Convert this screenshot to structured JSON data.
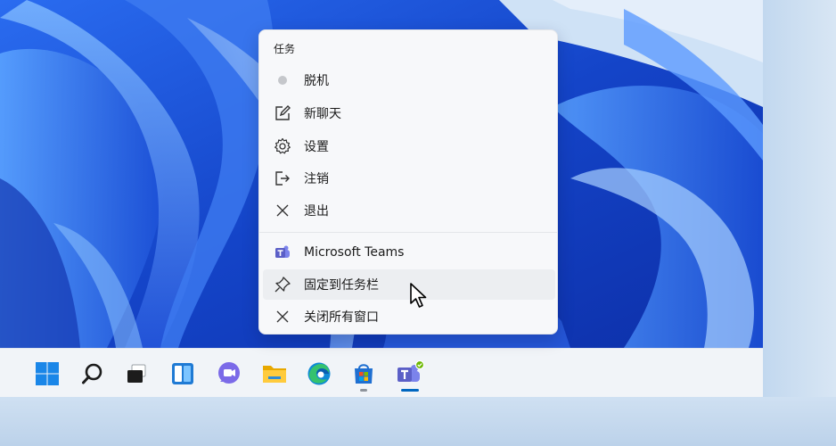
{
  "menu": {
    "header": "任务",
    "items": [
      {
        "label": "脱机",
        "icon": "status-dot-icon"
      },
      {
        "label": "新聊天",
        "icon": "compose-icon"
      },
      {
        "label": "设置",
        "icon": "gear-icon"
      },
      {
        "label": "注销",
        "icon": "sign-out-icon"
      },
      {
        "label": "退出",
        "icon": "close-icon"
      }
    ],
    "app_items": [
      {
        "label": "Microsoft Teams",
        "icon": "teams-icon"
      },
      {
        "label": "固定到任务栏",
        "icon": "pin-icon"
      },
      {
        "label": "关闭所有窗口",
        "icon": "close-icon"
      }
    ]
  },
  "taskbar": {
    "items": [
      {
        "name": "start-button",
        "icon": "windows-logo-icon"
      },
      {
        "name": "search-button",
        "icon": "search-icon"
      },
      {
        "name": "task-view-button",
        "icon": "task-view-icon"
      },
      {
        "name": "widgets-button",
        "icon": "widgets-icon"
      },
      {
        "name": "chat-button",
        "icon": "chat-icon"
      },
      {
        "name": "file-explorer-button",
        "icon": "folder-icon"
      },
      {
        "name": "edge-button",
        "icon": "edge-icon"
      },
      {
        "name": "store-button",
        "icon": "store-icon"
      },
      {
        "name": "teams-button",
        "icon": "teams-icon"
      }
    ]
  },
  "colors": {
    "wallpaper": "#1a4fd8",
    "taskbar": "#f1f4f8",
    "menu": "#f7f8fa",
    "accent": "#0067c0",
    "teams": "#5b5fc7"
  }
}
